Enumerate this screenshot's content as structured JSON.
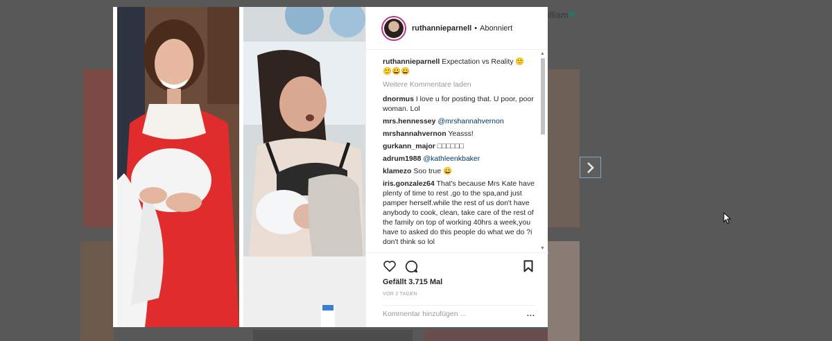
{
  "background": {
    "side_text": "illiam",
    "side_icon": "heart-icon"
  },
  "post": {
    "username": "ruthannieparnell",
    "separator": "•",
    "follow_status": "Abonniert",
    "caption_user": "ruthannieparnell",
    "caption_text": "Expectation vs Reality 🙂",
    "caption_emojis": "🙂😀😀",
    "load_more": "Weitere Kommentare laden",
    "comments": [
      {
        "user": "dnormus",
        "text": "I love u for posting that. U poor, poor woman. Lol"
      },
      {
        "user": "mrs.hennessey",
        "mention": "@mrshannahvernon"
      },
      {
        "user": "mrshannahvernon",
        "text": "Yeasss!"
      },
      {
        "user": "gurkann_major",
        "text": "□□□□□□"
      },
      {
        "user": "adrum1988",
        "mention": "@kathleenkbaker"
      },
      {
        "user": "klamezo",
        "text": "Soo true 😀"
      },
      {
        "user": "iris.gonzalez64",
        "text": "That's because Mrs Kate have plenty of time to rest ,go to the spa,and just pamper herself.while the rest of us don't have anybody to cook, clean, take care of the rest of the family on top of working 40hrs a week,you have to asked do this people do what we do ?i don't think so lol"
      }
    ],
    "likes": "Gefällt 3.715 Mal",
    "time_ago": "VOR 2 TAGEN",
    "comment_placeholder": "Kommentar hinzufügen ...",
    "more_options": "..."
  },
  "icons": {
    "like": "heart-outline-icon",
    "comment": "comment-bubble-icon",
    "save": "bookmark-icon",
    "next": "chevron-right-icon"
  },
  "colors": {
    "overlay": "#585858",
    "story_ring": "#c13584",
    "mention": "#003569",
    "muted": "#999999",
    "text": "#262626"
  }
}
